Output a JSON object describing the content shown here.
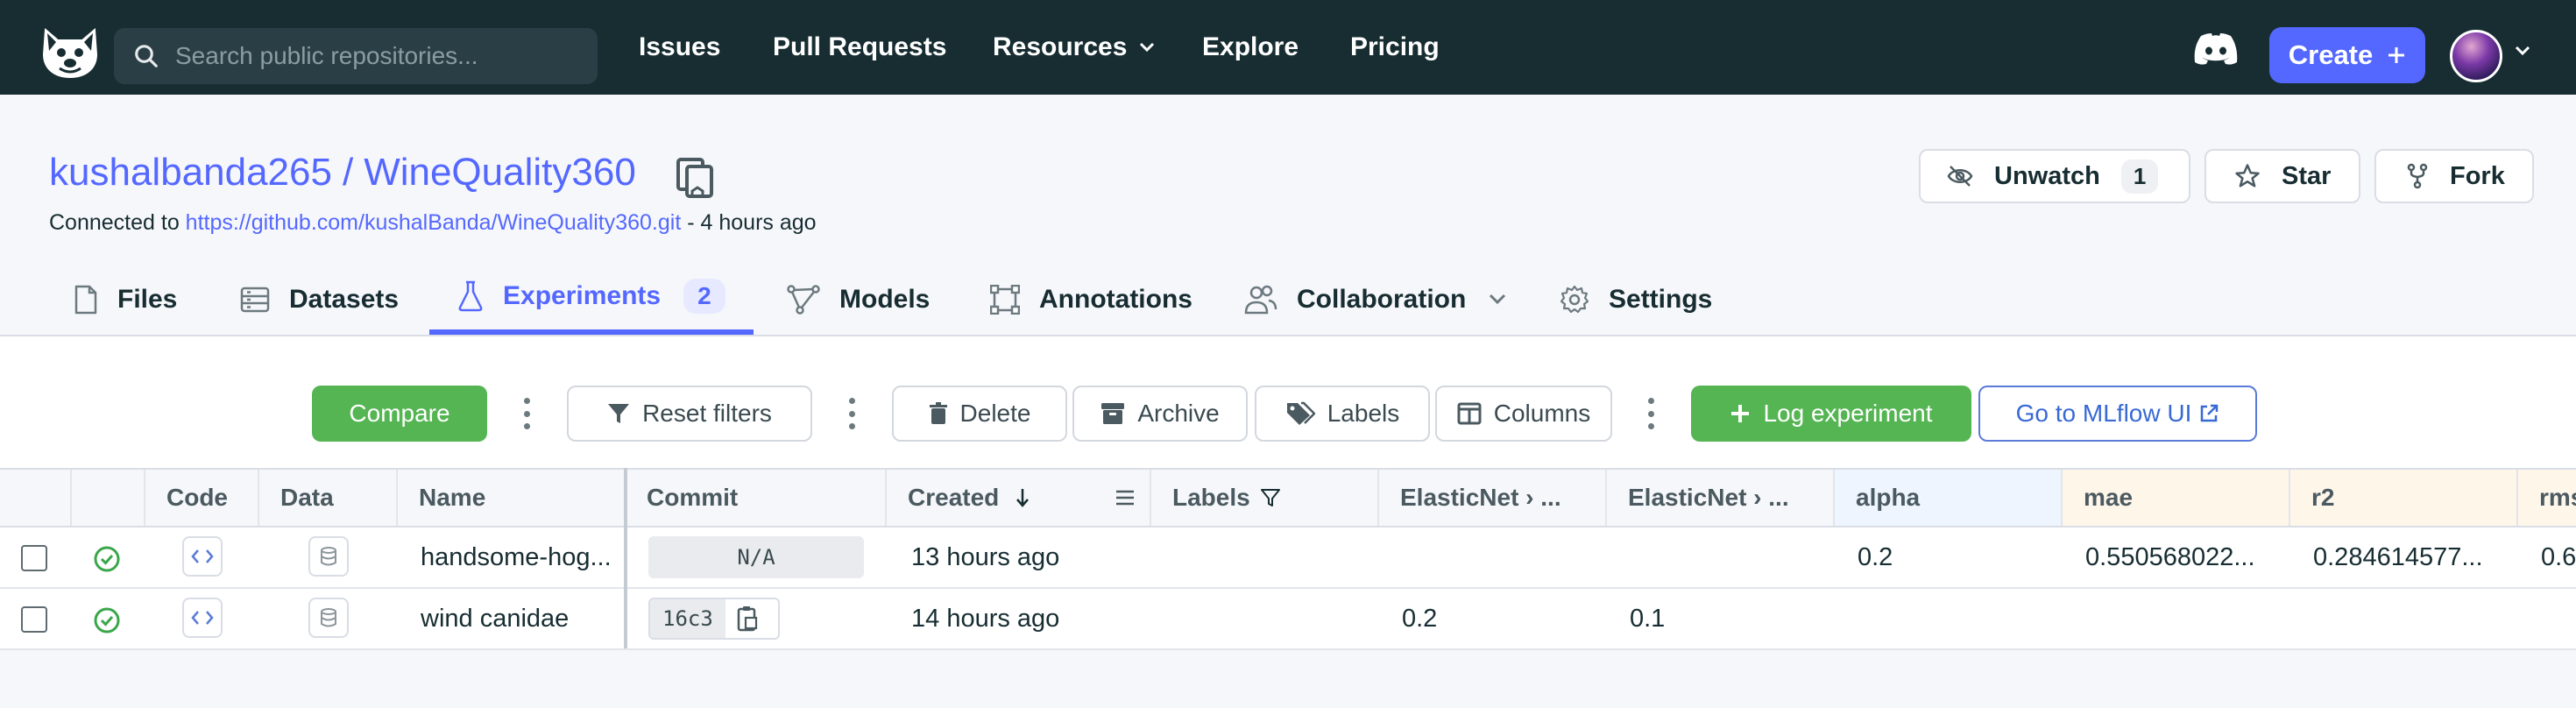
{
  "nav": {
    "search_placeholder": "Search public repositories...",
    "links": [
      "Issues",
      "Pull Requests",
      "Resources",
      "Explore",
      "Pricing"
    ],
    "create_label": "Create"
  },
  "repo": {
    "owner": "kushalbanda265",
    "separator": "/",
    "name": "WineQuality360",
    "connected_prefix": "Connected to",
    "git_url": "https://github.com/kushalBanda/WineQuality360.git",
    "connected_suffix": "- 4 hours ago",
    "unwatch_label": "Unwatch",
    "unwatch_count": "1",
    "star_label": "Star",
    "fork_label": "Fork"
  },
  "tabs": [
    {
      "label": "Files"
    },
    {
      "label": "Datasets"
    },
    {
      "label": "Experiments",
      "badge": "2"
    },
    {
      "label": "Models"
    },
    {
      "label": "Annotations"
    },
    {
      "label": "Collaboration"
    },
    {
      "label": "Settings"
    }
  ],
  "toolbar": {
    "compare": "Compare",
    "reset_filters": "Reset filters",
    "delete": "Delete",
    "archive": "Archive",
    "labels": "Labels",
    "columns": "Columns",
    "log_experiment": "Log experiment",
    "mlflow": "Go to MLflow UI"
  },
  "table": {
    "headers": {
      "code": "Code",
      "data": "Data",
      "name": "Name",
      "commit": "Commit",
      "created": "Created",
      "labels": "Labels",
      "en1": "ElasticNet › ...",
      "en2": "ElasticNet › ...",
      "alpha": "alpha",
      "mae": "mae",
      "r2": "r2",
      "rmse": "rms"
    },
    "rows": [
      {
        "name": "handsome-hog...",
        "commit": "N/A",
        "created": "13 hours ago",
        "en1": "",
        "en2": "",
        "alpha": "0.2",
        "mae": "0.550568022...",
        "r2": "0.284614577...",
        "rmse": "0.6"
      },
      {
        "name": "wind canidae",
        "commit": "16c3",
        "created": "14 hours ago",
        "en1": "0.2",
        "en2": "0.1",
        "alpha": "",
        "mae": "",
        "r2": "",
        "rmse": ""
      }
    ]
  },
  "colors": {
    "nav_bg": "#172d32",
    "accent": "#5468ff",
    "green": "#55b553",
    "status_ok": "#3aa64a"
  }
}
